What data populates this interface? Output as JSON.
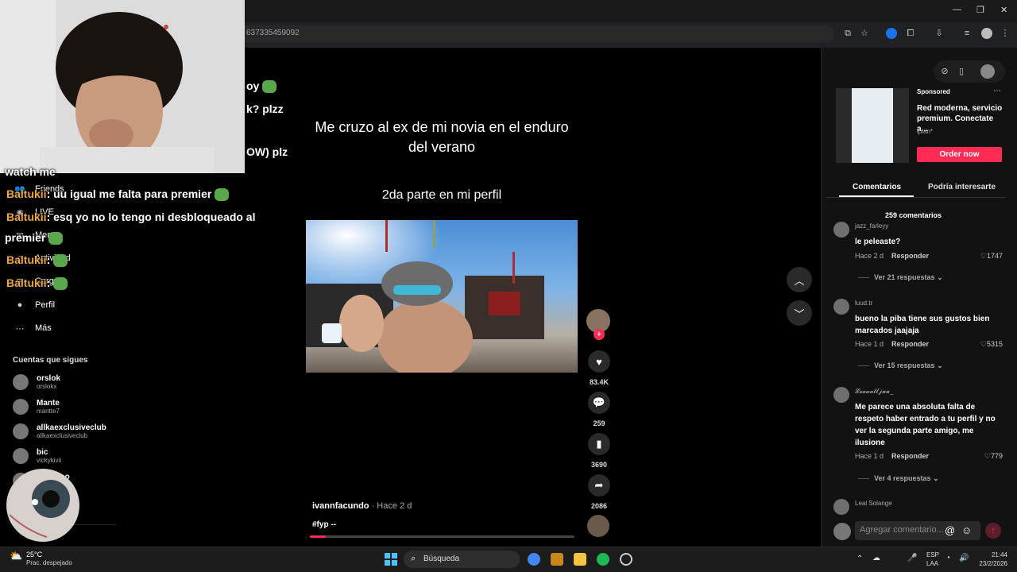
{
  "browser": {
    "url_fragment": "637335459092",
    "window_controls": [
      "—",
      "❐",
      "✕"
    ]
  },
  "sidebar": {
    "nav": [
      {
        "label": "Friends",
        "icon": "friends-icon",
        "glyph": "👥"
      },
      {
        "label": "LIVE",
        "icon": "live-icon",
        "glyph": "◉"
      },
      {
        "label": "Mens",
        "icon": "messages-icon",
        "glyph": "✉"
      },
      {
        "label": "Actividad",
        "icon": "activity-icon",
        "glyph": "◇"
      },
      {
        "label": "Cargar",
        "icon": "upload-icon",
        "glyph": "⊞"
      },
      {
        "label": "Perfil",
        "icon": "profile-icon",
        "glyph": "●"
      },
      {
        "label": "Más",
        "icon": "more-icon",
        "glyph": "⋯"
      }
    ],
    "following_title": "Cuentas que sigues",
    "following": [
      {
        "name": "orslok",
        "handle": "orslokx"
      },
      {
        "name": "Mante",
        "handle": "mantte7"
      },
      {
        "name": "allkaexclusiveclub",
        "handle": "allkaexclusiveclub"
      },
      {
        "name": "bic",
        "handle": "vickykivii"
      },
      {
        "name": "aroameo",
        "handle": "meo"
      }
    ]
  },
  "chat": [
    {
      "user": "",
      "text": "oy",
      "top": 0
    },
    {
      "user": "",
      "text": "k? plzz",
      "top": 0
    },
    {
      "user": "",
      "text": "OW) plz",
      "top": 0
    },
    {
      "user": "",
      "text": "watch me",
      "top": 0
    },
    {
      "user": "Baltukii",
      "text": ": uu igual me falta para premier",
      "top": 0
    },
    {
      "user": "Baltukii",
      "text": ": esq yo no lo tengo ni desbloqueado al",
      "top": 0
    },
    {
      "user": "",
      "text": "premier",
      "top": 0
    },
    {
      "user": "Baltukii",
      "text": ":",
      "top": 0
    },
    {
      "user": "Baltukii",
      "text": ":",
      "top": 0
    }
  ],
  "video": {
    "caption": "Me cruzo al ex de mi novia en el enduro del verano",
    "subcaption": "2da parte en mi perfil",
    "author": "ivannfacundo",
    "time": "· Hace 2 d",
    "hashtag": "#fyp --",
    "progress": 0.06,
    "likes": "83.4K",
    "comments": "259",
    "saves": "3690",
    "shares": "2086"
  },
  "right_panel": {
    "sponsored_label": "Sponsored",
    "ad_text": "Red moderna, servicio premium. Conectate a...",
    "ad_brand": "iplan*",
    "ad_button": "Order now",
    "tabs": [
      "Comentarios",
      "Podría interesarte"
    ],
    "comment_count": "259 comentarios",
    "comments": [
      {
        "user": "jazz_farleyy",
        "text": "le peleaste?",
        "time": "Hace 2 d",
        "reply": "Responder",
        "likes": "1747",
        "more": "Ver 21 respuestas"
      },
      {
        "user": "luud.tr",
        "text": "bueno la piba tiene sus gustos bien marcados jaajaja",
        "time": "Hace 1 d",
        "reply": "Responder",
        "likes": "5315",
        "more": "Ver 15 respuestas"
      },
      {
        "user": "𝓛𝓮𝓪𝓪𝓪𝓵𝓵𝓳𝓾𝓾_",
        "text": "Me parece una absoluta falta de respeto haber entrado a tu perfil y no ver la segunda parte amigo, me ilusione",
        "time": "Hace 1 d",
        "reply": "Responder",
        "likes": "779",
        "more": "Ver 4 respuestas"
      },
      {
        "user": "Leal Solange",
        "text": "",
        "time": "",
        "reply": "",
        "likes": "",
        "more": ""
      }
    ],
    "comment_placeholder": "Agregar comentario..."
  },
  "taskbar": {
    "weather_temp": "25°C",
    "weather_desc": "Prac. despejado",
    "search_label": "Búsqueda",
    "lang": "ESP",
    "lang2": "LAA",
    "time": "21:44",
    "date": "23/2/2026"
  }
}
